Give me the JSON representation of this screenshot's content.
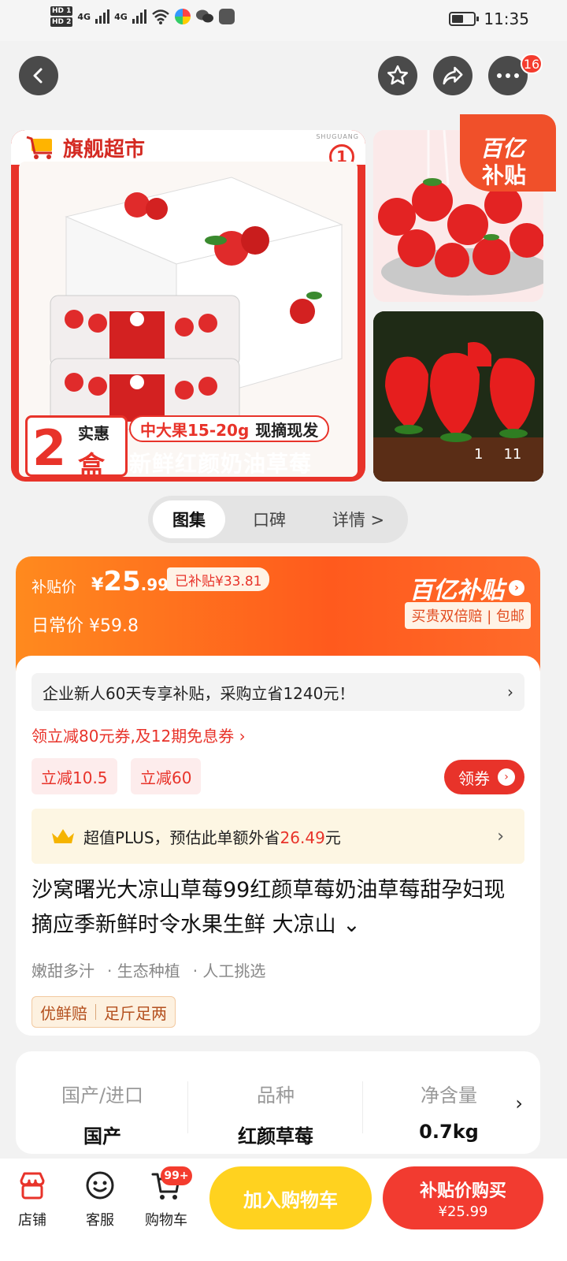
{
  "status_bar": {
    "time": "11:35",
    "sim1": "HD 1",
    "sim2": "HD 2",
    "net1": "4G",
    "net2": "4G"
  },
  "nav": {
    "back_icon": "chevron-left-icon",
    "favorite_icon": "star-icon",
    "share_icon": "share-icon",
    "more_icon": "more-icon",
    "more_badge": "16"
  },
  "gallery": {
    "store_tag": "旗舰超市",
    "index_badge": "1",
    "brand_mark": "SHUGUANG",
    "promo_count": "2",
    "promo_shihui": "实惠",
    "promo_unit": "盒",
    "promo_size": "中大果15-20g",
    "promo_fresh": "现摘现发",
    "promo_title": "新鲜红颜奶油草莓",
    "subsidy_badge_line1": "百亿",
    "subsidy_badge_line2": "补贴",
    "pager_current": "1",
    "pager_total": "11"
  },
  "tabs": [
    {
      "label": "图集",
      "active": true
    },
    {
      "label": "口碑",
      "active": false
    },
    {
      "label": "详情 >",
      "active": false
    }
  ],
  "price": {
    "subsidy_label": "补贴价",
    "currency": "¥",
    "subsidy_int": "25",
    "subsidy_dec": ".99",
    "already_subsidized": "已补贴¥33.81",
    "daily_label": "日常价",
    "daily_price": "¥59.8",
    "program_name": "百亿补贴",
    "guarantee": "买贵双倍赔 | 包邮"
  },
  "offers": {
    "new_user": "企业新人60天专享补贴，采购立省1240元！",
    "coupon_text": "领立减80元券,及12期免息券 ›",
    "chip1": "立减10.5",
    "chip2": "立减60",
    "claim_button": "领券",
    "plus_prefix": "超值PLUS，预估此单额外省",
    "plus_amount": "26.49",
    "plus_suffix": "元"
  },
  "product": {
    "title": "沙窝曙光大凉山草莓99红颜草莓奶油草莓甜孕妇现摘应季新鲜时令水果生鲜 大凉山 ⌄",
    "features": [
      "嫩甜多汁",
      "· 生态种植",
      "· 人工挑选"
    ],
    "tags": [
      "优鲜赔",
      "足斤足两"
    ]
  },
  "specs": [
    {
      "key": "国产/进口",
      "value": "国产"
    },
    {
      "key": "品种",
      "value": "红颜草莓"
    },
    {
      "key": "净含量",
      "value": "0.7kg"
    }
  ],
  "bottom_bar": {
    "store": "店铺",
    "service": "客服",
    "cart": "购物车",
    "cart_badge": "99+",
    "add_to_cart": "加入购物车",
    "buy_label": "补贴价购买",
    "buy_price": "¥25.99"
  },
  "colors": {
    "accent_red": "#e8332a",
    "orange": "#ff5a1d",
    "yellow": "#ffd21f"
  }
}
